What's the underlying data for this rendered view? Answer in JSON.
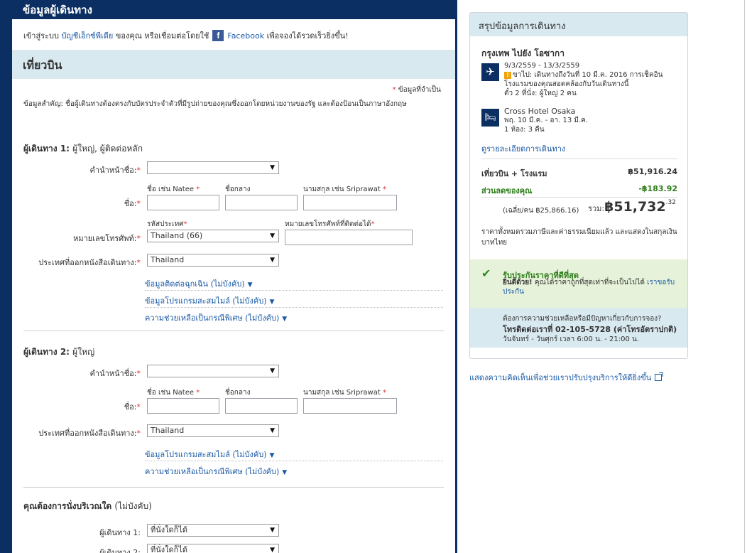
{
  "header": {
    "title": "ข้อมูลผู้เดินทาง"
  },
  "signin": {
    "prefix": "เข้าสู่ระบบ",
    "account_link": "บัญชีเอ็กซ์พีเดีย",
    "middle": "ของคุณ หรือเชื่อมต่อโดยใช้",
    "facebook_icon": "facebook-icon",
    "facebook_link": "Facebook",
    "suffix": "เพื่อจองได้รวดเร็วยิ่งขึ้น!"
  },
  "flight_section": {
    "title": "เที่ยวบิน"
  },
  "required_note": "ข้อมูลที่จำเป็น",
  "important_note": "ข้อมูลสำคัญ: ชื่อผู้เดินทางต้องตรงกับบัตรประจำตัวที่มีรูปถ่ายของคุณซึ่งออกโดยหน่วยงานของรัฐ และต้องป้อนเป็นภาษาอังกฤษ",
  "traveler1": {
    "title": "ผู้เดินทาง 1:",
    "subtitle": "ผู้ใหญ่, ผู้ติดต่อหลัก",
    "title_label": "คำนำหน้าชื่อ:",
    "title_value": "",
    "name_label": "ชื่อ:",
    "first_name_hint": "ชื่อ เช่น Natee",
    "middle_name_hint": "ชื่อกลาง",
    "last_name_hint": "นามสกุล เช่น Sriprawat",
    "country_code_label": "รหัสประเทศ",
    "phone_label": "หมายเลขโทรศัพท์:",
    "phone_hint": "หมายเลขโทรศัพท์ที่ติดต่อได้",
    "country_code_value": "Thailand (66)",
    "passport_label": "ประเทศที่ออกหนังสือเดินทาง:",
    "passport_value": "Thailand",
    "link_emergency": "ข้อมูลติดต่อฉุกเฉิน (ไม่บังคับ)",
    "link_loyalty": "ข้อมูลโปรแกรมสะสมไมล์ (ไม่บังคับ)",
    "link_assist": "ความช่วยเหลือเป็นกรณีพิเศษ (ไม่บังคับ)"
  },
  "traveler2": {
    "title": "ผู้เดินทาง 2:",
    "subtitle": "ผู้ใหญ่",
    "title_label": "คำนำหน้าชื่อ:",
    "title_value": "",
    "name_label": "ชื่อ:",
    "first_name_hint": "ชื่อ เช่น Natee",
    "middle_name_hint": "ชื่อกลาง",
    "last_name_hint": "นามสกุล เช่น Sriprawat",
    "passport_label": "ประเทศที่ออกหนังสือเดินทาง:",
    "passport_value": "Thailand",
    "link_loyalty": "ข้อมูลโปรแกรมสะสมไมล์ (ไม่บังคับ)",
    "link_assist": "ความช่วยเหลือเป็นกรณีพิเศษ (ไม่บังคับ)"
  },
  "seating": {
    "title": "คุณต้องการนั่งบริเวณใด",
    "optional": "(ไม่บังคับ)",
    "p1_label": "ผู้เดินทาง 1:",
    "p1_value": "ที่นั่งใดก็ได้",
    "p2_label": "ผู้เดินทาง 2:",
    "p2_value": "ที่นั่งใดก็ได้"
  },
  "summary": {
    "title": "สรุปข้อมูลการเดินทาง",
    "route": "กรุงเทพ ไปยัง โอซากา",
    "flight_icon": "airplane-icon",
    "flight_dates": "9/3/2559 - 13/3/2559",
    "flight_warning": "ขาไป: เดินทางถึงวันที่ 10 มี.ค. 2016 การเช็คอินโรงแรมของคุณสอดคล้องกับวันเดินทางนี้",
    "flight_pax": "ตั๋ว 2 ที่นั่ง: ผู้ใหญ่ 2 คน",
    "hotel_icon": "bed-icon",
    "hotel_name": "Cross Hotel Osaka",
    "hotel_dates": "พฤ. 10 มี.ค. - อา. 13 มี.ค.",
    "hotel_rooms": "1 ห้อง: 3 คืน",
    "trip_link": "ดูรายละเอียดการเดินทาง",
    "package_label": "เที่ยวบิน + โรงแรม",
    "package_price": "฿51,916.24",
    "saving_label": "ส่วนลดของคุณ",
    "saving_value": "-฿183.92",
    "avg_label": "(เฉลี่ย/คน ฿25,866.16)",
    "total_label": "รวม:",
    "total_value": "฿51,732",
    "total_cents": ".32",
    "tax_note": "ราคาทั้งหมดรวมภาษีและค่าธรรมเนียมแล้ว และแสดงในสกุลเงิน บาทไทย",
    "guarantee_title": "รับประกันราคาที่ดีที่สุด",
    "guarantee_bold": "ยินดีด้วย!",
    "guarantee_text": "คุณได้ราคาถูกที่สุดเท่าที่จะเป็นไปได้",
    "guarantee_link": "เราขอรับประกัน",
    "help_line1": "ต้องการความช่วยเหลือหรือมีปัญหาเกี่ยวกับการจอง?",
    "help_line2": "โทรติดต่อเราที่ 02-105-5728 (ค่าโทรอัตราปกติ)",
    "help_line3": "วันจันทร์ - วันศุกร์ เวลา 6:00 น. - 21:00 น."
  },
  "feedback": {
    "label": "แสดงความคิดเห็นเพื่อช่วยเราปรับปรุงบริการให้ดียิ่งขึ้น"
  }
}
